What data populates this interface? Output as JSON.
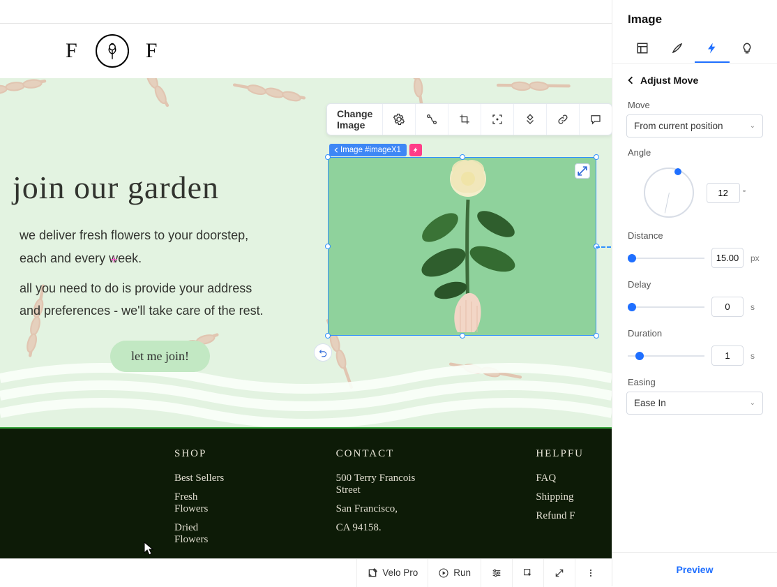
{
  "header": {
    "letter": "F"
  },
  "elemToolbar": {
    "changeImage": "Change Image"
  },
  "badge": {
    "imageLabel": "Image #imageX1"
  },
  "hero": {
    "title": "join our garden",
    "sub1": "we deliver fresh flowers to your doorstep,",
    "sub2": "each and every week.",
    "sub3": "all you need to do is provide your address",
    "sub4": "and preferences - we'll take care of the rest.",
    "button": "let me join!"
  },
  "footer": {
    "shop": {
      "title": "SHOP",
      "items": [
        "Best Sellers",
        "Fresh Flowers",
        "Dried Flowers"
      ]
    },
    "contact": {
      "title": "CONTACT",
      "lines": [
        "500 Terry Francois Street",
        "San Francisco,",
        "CA 94158."
      ]
    },
    "links": {
      "title": "HELPFU",
      "items": [
        "FAQ",
        "Shipping",
        "Refund F"
      ]
    }
  },
  "panel": {
    "title": "Image",
    "back": "Adjust Move",
    "moveLabel": "Move",
    "moveValue": "From current position",
    "angleLabel": "Angle",
    "angleValue": "12",
    "angleUnit": "°",
    "distLabel": "Distance",
    "distValue": "15.00",
    "distUnit": "px",
    "delayLabel": "Delay",
    "delayValue": "0",
    "delayUnit": "s",
    "durLabel": "Duration",
    "durValue": "1",
    "durUnit": "s",
    "easeLabel": "Easing",
    "easeValue": "Ease In",
    "preview": "Preview"
  },
  "bottom": {
    "velo": "Velo Pro",
    "run": "Run"
  }
}
